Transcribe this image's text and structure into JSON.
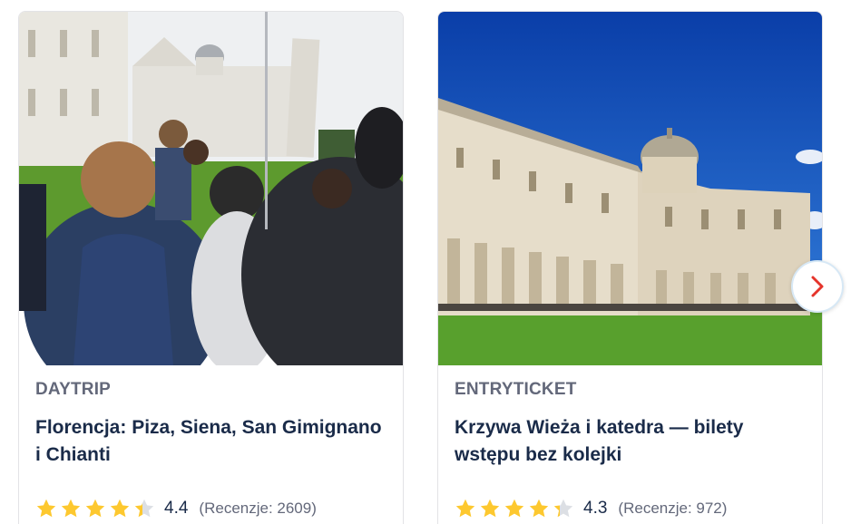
{
  "cards": [
    {
      "category": "DAYTRIP",
      "title": "Florencja: Piza, Siena, San Gimignano i Chianti",
      "image_alt": "Group of tourists with a guide in front of the Leaning Tower of Pisa and cathedral",
      "rating": "4.4",
      "rating_fraction": 0.88,
      "reviews": "(Recenzje: 2609)"
    },
    {
      "category": "ENTRYTICKET",
      "title": "Krzywa Wieża i katedra — bilety wstępu bez kolejki",
      "image_alt": "Pisa Cathedral on the Piazza dei Miracoli under a blue sky",
      "rating": "4.3",
      "rating_fraction": 0.86,
      "reviews": "(Recenzje: 972)"
    }
  ],
  "icons": {
    "star": "star-icon",
    "next": "chevron-right-icon"
  },
  "colors": {
    "star": "#fdc82f",
    "star_empty": "#dcdfe4",
    "title": "#1a2b49",
    "category": "#63687a",
    "chevron": "#e5342b"
  }
}
